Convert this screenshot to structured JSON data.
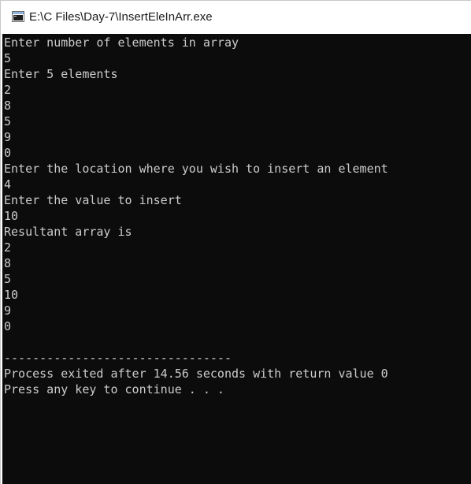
{
  "window": {
    "title": "E:\\C Files\\Day-7\\InsertEleInArr.exe"
  },
  "console": {
    "lines": [
      "Enter number of elements in array",
      "5",
      "Enter 5 elements",
      "2",
      "8",
      "5",
      "9",
      "0",
      "Enter the location where you wish to insert an element",
      "4",
      "Enter the value to insert",
      "10",
      "Resultant array is",
      "2",
      "8",
      "5",
      "10",
      "9",
      "0",
      "",
      "--------------------------------",
      "Process exited after 14.56 seconds with return value 0",
      "Press any key to continue . . ."
    ]
  },
  "colors": {
    "console_background": "#0c0c0c",
    "console_text": "#cccccc",
    "titlebar_background": "#ffffff"
  },
  "icons": {
    "app": "console-window-icon"
  }
}
